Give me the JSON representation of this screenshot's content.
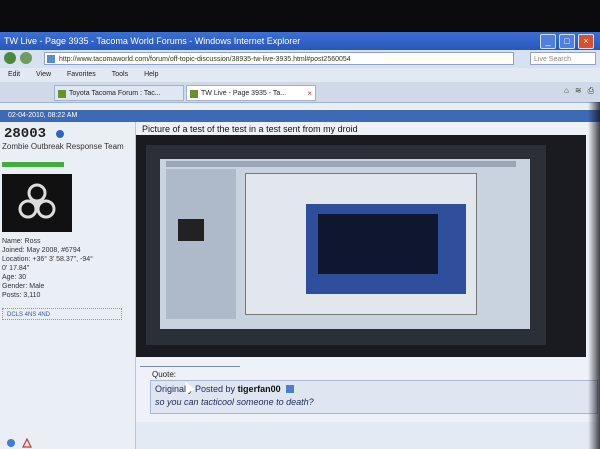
{
  "window": {
    "title": "TW Live - Page 3935 - Tacoma World Forums - Windows Internet Explorer"
  },
  "address_bar": {
    "url": "http://www.tacomaworld.com/forum/off-topic-discussion/38935-tw-live-3935.html#post2560054",
    "search_placeholder": "Live Search"
  },
  "menu": {
    "items": [
      "Edit",
      "View",
      "Favorites",
      "Tools",
      "Help"
    ]
  },
  "tabs": [
    {
      "label": "Toyota Tacoma Forum : Tac...",
      "active": false
    },
    {
      "label": "TW Live - Page 3935 - Ta...",
      "active": true
    }
  ],
  "post": {
    "header_timestamp": "02-04-2010, 08:22 AM",
    "caption": "Picture of a test of the test in a test sent from my droid",
    "quote_label": "Quote:",
    "quote_originally": "Originally Posted by",
    "quote_poster": "tigerfan00",
    "quote_text": "so you can tacticool someone to death?"
  },
  "user": {
    "name": "28003",
    "title": "Zombie Outbreak Response Team",
    "info": [
      "Name: Ross",
      "Joined: May 2008, #6794",
      "Location: +36° 3' 58.37\", -94°",
      "0' 17.84\"",
      "Age: 30",
      "Gender: Male",
      "Posts: 3,110"
    ],
    "dcls_link": "DCLS 4NS 4ND"
  },
  "colors": {
    "titlebar": "#2a57b8",
    "row_header": "#3e69b6",
    "reputation": "#3fae3f"
  }
}
